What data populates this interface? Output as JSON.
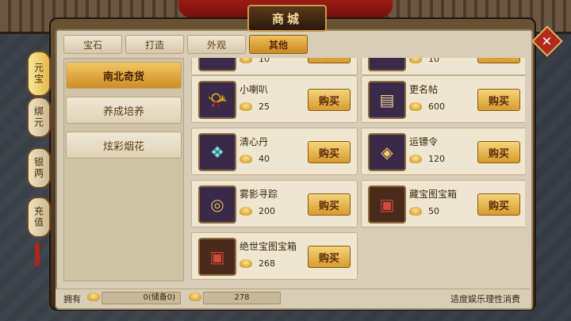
{
  "title": "商城",
  "tabs": [
    "宝石",
    "打造",
    "外观",
    "其他"
  ],
  "side_tabs": [
    "元宝",
    "绑元",
    "银两",
    "充值"
  ],
  "categories": [
    "南北奇货",
    "养成培养",
    "炫彩烟花"
  ],
  "items": [
    {
      "name": "",
      "price": "10",
      "icon": "partial-item-icon"
    },
    {
      "name": "",
      "price": "10",
      "icon": "partial-item-icon"
    },
    {
      "name": "小喇叭",
      "price": "25",
      "icon": "horn-icon"
    },
    {
      "name": "更名帖",
      "price": "600",
      "icon": "scroll-book-icon"
    },
    {
      "name": "清心丹",
      "price": "40",
      "icon": "pill-icon"
    },
    {
      "name": "运镖令",
      "price": "120",
      "icon": "token-icon"
    },
    {
      "name": "雾影寻踪",
      "price": "200",
      "icon": "compass-icon"
    },
    {
      "name": "藏宝图宝箱",
      "price": "50",
      "icon": "chest-icon"
    },
    {
      "name": "绝世宝图宝箱",
      "price": "268",
      "icon": "chest-icon"
    }
  ],
  "buy_label": "购买",
  "bottom": {
    "own_label": "拥有",
    "own_value": "0(储备0)",
    "bound_value": "278",
    "notice": "适度娱乐理性消费"
  },
  "close_label": "✕"
}
